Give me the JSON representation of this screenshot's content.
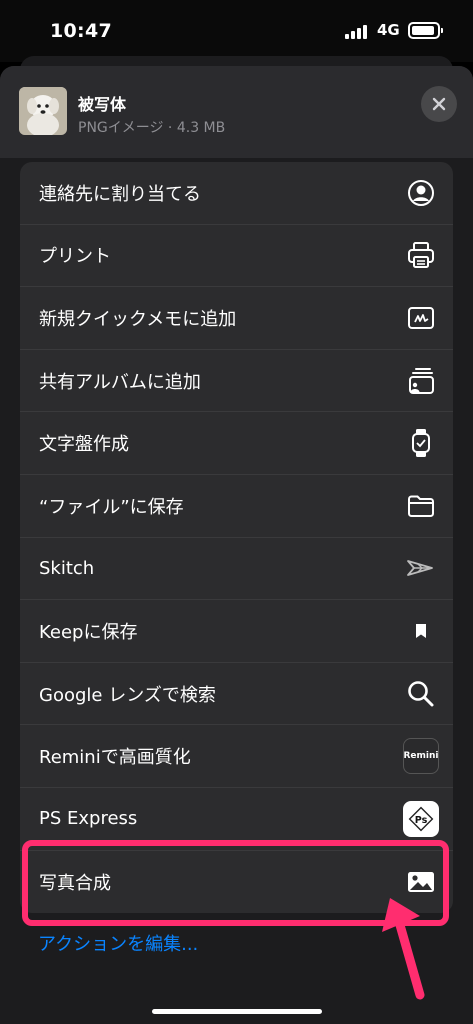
{
  "status_bar": {
    "time": "10:47",
    "network": "4G"
  },
  "header": {
    "file_name": "被写体",
    "file_info": "PNGイメージ · 4.3 MB"
  },
  "actions": [
    {
      "label": "連絡先に割り当てる",
      "icon": "person-circle-icon"
    },
    {
      "label": "プリント",
      "icon": "printer-icon"
    },
    {
      "label": "新規クイックメモに追加",
      "icon": "quick-note-icon"
    },
    {
      "label": "共有アルバムに追加",
      "icon": "shared-album-icon"
    },
    {
      "label": "文字盤作成",
      "icon": "watch-icon"
    },
    {
      "label": "“ファイル”に保存",
      "icon": "folder-icon"
    },
    {
      "label": "Skitch",
      "icon": "skitch-arrow-icon"
    },
    {
      "label": "Keepに保存",
      "icon": "bookmark-icon"
    },
    {
      "label": "Google レンズで検索",
      "icon": "magnifier-icon"
    },
    {
      "label": "Reminiで高画質化",
      "icon": "remini-app-icon",
      "badge": "Remini"
    },
    {
      "label": "PS Express",
      "icon": "ps-express-app-icon",
      "badge": "Ps"
    },
    {
      "label": "写真合成",
      "icon": "photo-icon"
    }
  ],
  "edit_actions_label": "アクションを編集...",
  "colors": {
    "highlight": "#ff2d6f",
    "link": "#0a84ff",
    "sheet_bg": "#1c1c1e",
    "row_bg": "#2c2c2e"
  }
}
